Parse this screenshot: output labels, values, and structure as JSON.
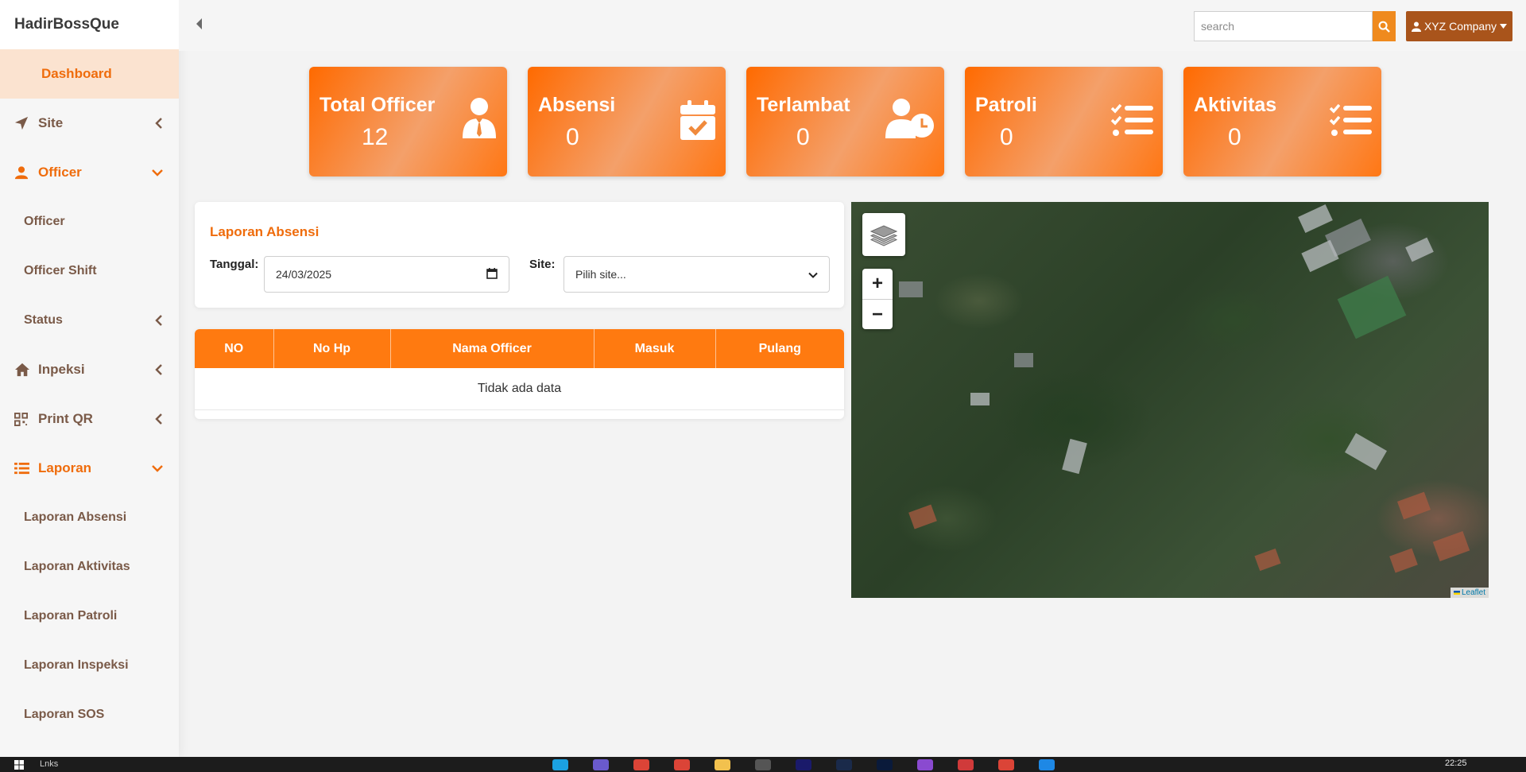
{
  "brand": "HadirBossQue",
  "sidebar": {
    "active": "Dashboard",
    "items": [
      {
        "label": "Site"
      },
      {
        "label": "Officer"
      },
      {
        "label": "Officer"
      },
      {
        "label": "Officer Shift"
      },
      {
        "label": "Status"
      },
      {
        "label": "Inpeksi"
      },
      {
        "label": "Print QR"
      },
      {
        "label": "Laporan"
      },
      {
        "label": "Laporan Absensi"
      },
      {
        "label": "Laporan Aktivitas"
      },
      {
        "label": "Laporan Patroli"
      },
      {
        "label": "Laporan Inspeksi"
      },
      {
        "label": "Laporan SOS"
      }
    ]
  },
  "topbar": {
    "search_placeholder": "search",
    "company": "XYZ Company"
  },
  "cards": [
    {
      "title": "Total Officer",
      "value": "12"
    },
    {
      "title": "Absensi",
      "value": "0"
    },
    {
      "title": "Terlambat",
      "value": "0"
    },
    {
      "title": "Patroli",
      "value": "0"
    },
    {
      "title": "Aktivitas",
      "value": "0"
    }
  ],
  "laporan": {
    "title": "Laporan Absensi",
    "tanggal_label": "Tanggal:",
    "tanggal_value": "24/03/2025",
    "site_label": "Site:",
    "site_value": "Pilih site..."
  },
  "table": {
    "columns": [
      "NO",
      "No Hp",
      "Nama Officer",
      "Masuk",
      "Pulang"
    ],
    "empty": "Tidak ada data"
  },
  "map": {
    "zoom_in": "+",
    "zoom_out": "−",
    "attribution": "Leaflet"
  },
  "taskbar": {
    "search": "Lnks",
    "time": "22:25"
  },
  "colors": {
    "accent": "#ef6c0c",
    "card_orange": "#ff6a00",
    "company_btn": "#a9541b"
  }
}
